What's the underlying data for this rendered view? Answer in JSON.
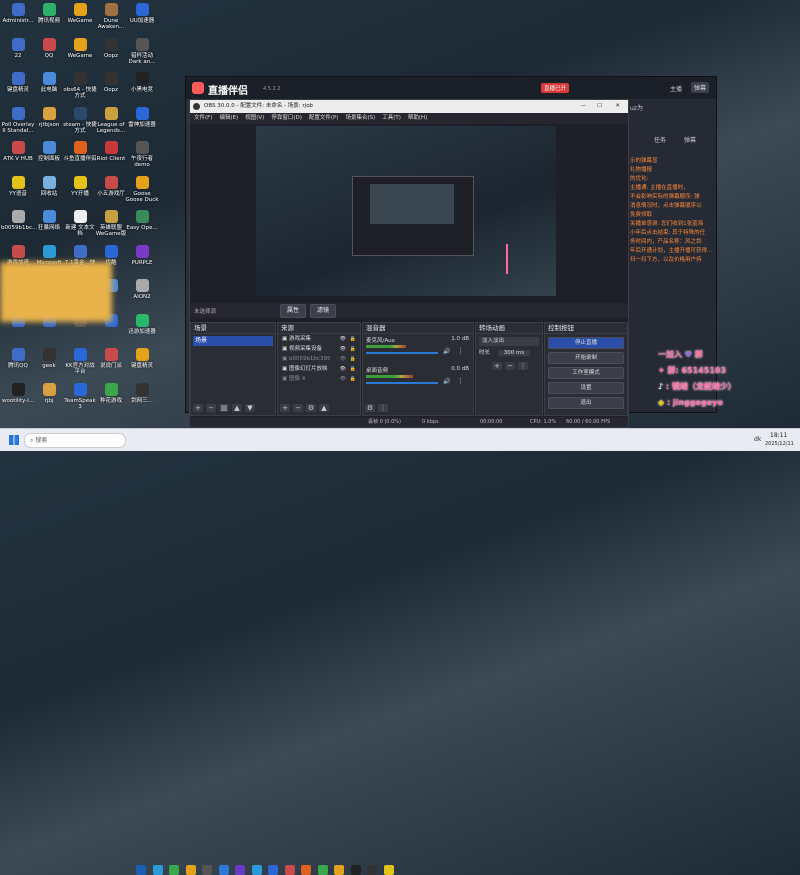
{
  "desktop_icons": [
    {
      "label": "Administr...",
      "color": "#3f6cc6"
    },
    {
      "label": "腾讯视频",
      "color": "#2bb36a"
    },
    {
      "label": "WeGame",
      "color": "#e3a21a"
    },
    {
      "label": "Dune Awaken...",
      "color": "#a07040"
    },
    {
      "label": "UU加速器",
      "color": "#2a68d8"
    },
    {
      "label": "22",
      "color": "#3f6cc6"
    },
    {
      "label": "QQ",
      "color": "#c84a4a"
    },
    {
      "label": "WeGame",
      "color": "#e3a21a"
    },
    {
      "label": "Oopz",
      "color": "#333333"
    },
    {
      "label": "猎杯活动 Dark an...",
      "color": "#555555"
    },
    {
      "label": "键盘精灵",
      "color": "#3f6cc6"
    },
    {
      "label": "此电脑",
      "color": "#4a8ad8"
    },
    {
      "label": "obs64 - 快捷方式",
      "color": "#333333"
    },
    {
      "label": "Oopz",
      "color": "#333333"
    },
    {
      "label": "小黑电竞",
      "color": "#222222"
    },
    {
      "label": "Poll Overlay II Standal...",
      "color": "#3f6cc6"
    },
    {
      "label": "rjtbjson",
      "color": "#d8a040"
    },
    {
      "label": "steam - 快捷方式",
      "color": "#2a4a6a"
    },
    {
      "label": "League of Legends...",
      "color": "#c8a040"
    },
    {
      "label": "雷神加速器",
      "color": "#2a68d8"
    },
    {
      "label": "ATK V HUB",
      "color": "#c84a4a"
    },
    {
      "label": "控制面板",
      "color": "#4a8ad8"
    },
    {
      "label": "斗鱼直播伴侣",
      "color": "#e06020"
    },
    {
      "label": "Riot Client",
      "color": "#c83a3a"
    },
    {
      "label": "午夜行者 demo",
      "color": "#555555"
    },
    {
      "label": "YY语音",
      "color": "#e3c21a"
    },
    {
      "label": "回收站",
      "color": "#7ab0e0"
    },
    {
      "label": "YY开播",
      "color": "#e3c21a"
    },
    {
      "label": "小五游戏厅",
      "color": "#c84a4a"
    },
    {
      "label": "Goose Goose Duck",
      "color": "#e3a21a"
    },
    {
      "label": "b0059b1bc...",
      "color": "#aaaaaa"
    },
    {
      "label": "狂暴网络",
      "color": "#4a8ad8"
    },
    {
      "label": "新建 文本文档",
      "color": "#eeeeee"
    },
    {
      "label": "英雄联盟WeGame版",
      "color": "#c8a040"
    },
    {
      "label": "Easy Ope...",
      "color": "#3a8a5a"
    },
    {
      "label": "游戏加速",
      "color": "#c84a4a"
    },
    {
      "label": "Microsoft Edge",
      "color": "#2a9ad8"
    },
    {
      "label": "7.1黄金...快捷方式",
      "color": "#3f6cc6"
    },
    {
      "label": "优酷",
      "color": "#2a68d8"
    },
    {
      "label": "PURPLE",
      "color": "#7a3ac8"
    },
    {
      "label": "",
      "color": "#e3c21a"
    },
    {
      "label": "",
      "color": "#e3c21a"
    },
    {
      "label": "",
      "color": "#c84a4a"
    },
    {
      "label": "",
      "color": "#4a8ad8"
    },
    {
      "label": "AION2",
      "color": "#aaaaaa"
    },
    {
      "label": "",
      "color": "#2a68d8"
    },
    {
      "label": "",
      "color": "#2a68d8"
    },
    {
      "label": "",
      "color": "#555555"
    },
    {
      "label": "",
      "color": "#2a68d8"
    },
    {
      "label": "迅游加速器",
      "color": "#2ab86a"
    },
    {
      "label": "腾讯QQ",
      "color": "#3f6cc6"
    },
    {
      "label": "geek",
      "color": "#333333"
    },
    {
      "label": "KK官方对战平台",
      "color": "#2a68d8"
    },
    {
      "label": "说说门派",
      "color": "#c84a4a"
    },
    {
      "label": "键盘精灵",
      "color": "#e3a21a"
    },
    {
      "label": "wootility-l...",
      "color": "#222222"
    },
    {
      "label": "rjbj",
      "color": "#d8a040"
    },
    {
      "label": "TeamSpeak 3",
      "color": "#2a68d8"
    },
    {
      "label": "种花游戏",
      "color": "#3aa84a"
    },
    {
      "label": "剑网三...",
      "color": "#333333"
    }
  ],
  "helper": {
    "title": "直播伴侣",
    "version": "4.5.2.2",
    "badge": "直播已开",
    "tabs": [
      "主播",
      "弹幕"
    ],
    "right_text": [
      "uz为",
      "任务",
      "弹幕"
    ],
    "notice_lines": [
      "示的弹幕显",
      "礼物播报",
      "的优化: ",
      "主播通: 主播在直播时，",
      "不会影响实际的弹幕顺序; 弹",
      "消息情况时，点击弹幕顺序以",
      "免费领取",
      "关播单感谢: 您们收到1张蓝海",
      "小年后点击结束: 其于特殊的任",
      "务时间内，产品名称：风之剑",
      "年后开通计划，主播开播可获得...",
      "扫一扫下方，以及价格用户持"
    ]
  },
  "obs": {
    "title": "OBS 30.0.0 - 配置文件: 未命名 - 场景: rjob",
    "menu": [
      "文件(F)",
      "编辑(E)",
      "视图(V)",
      "停靠窗口(D)",
      "配置文件(P)",
      "场景集合(S)",
      "工具(T)",
      "帮助(H)"
    ],
    "no_source": "未选择源",
    "props_label": "属性",
    "filters_label": "滤镜",
    "scenes": {
      "title": "场景",
      "items": [
        "场景"
      ]
    },
    "sources": {
      "title": "来源",
      "items": [
        "游戏采集",
        "视频采集设备",
        "b0059b1bc395",
        "图像幻灯片放映",
        "图像 4"
      ]
    },
    "mixer": {
      "title": "混音器",
      "tracks": [
        {
          "name": "麦克风/Aux",
          "db": "1.0 dB",
          "level": 0.55
        },
        {
          "name": "桌面音频",
          "db": "0.0 dB",
          "level": 0.65
        }
      ]
    },
    "transitions": {
      "title": "转场动画",
      "type": "淡入淡出",
      "duration_label": "时长",
      "duration": "300 ms"
    },
    "controls": {
      "title": "控制按钮",
      "buttons": [
        "停止直播",
        "开始录制",
        "工作室模式",
        "设置",
        "退出"
      ]
    },
    "status": {
      "dropped": "丢帧 0 (0.0%)",
      "bitrate": "0 kbps",
      "time": "00:00:00",
      "cpu": "CPU: 1.0%",
      "fps": "60.00 / 60.00 FPS"
    }
  },
  "overlay": {
    "line1": "一加入",
    "line1b": "群",
    "line2": "群: 65145103",
    "line3": ": 镜靖（龙妮靖少）",
    "line4": ": jinggegeyo"
  },
  "taskbar": {
    "search_placeholder": "搜索",
    "clock_time": "18:11",
    "clock_date": "2025/12/11",
    "tray_text": "dk"
  },
  "colors": {
    "accent": "#2b4fa8",
    "overlay_pink": "#ff6aa0",
    "stop_button": "#2b4fa8"
  }
}
